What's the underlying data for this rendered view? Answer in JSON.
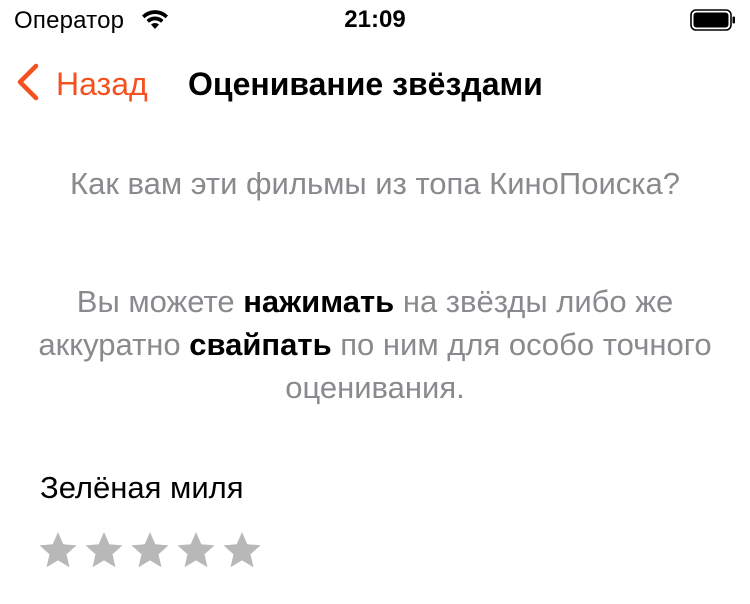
{
  "status_bar": {
    "carrier": "Оператор",
    "time": "21:09"
  },
  "nav": {
    "back_label": "Назад",
    "title": "Оценивание звёздами"
  },
  "content": {
    "question": "Как вам эти фильмы из топа КиноПоиска?",
    "instructions": {
      "part1": "Вы можете ",
      "bold1": "нажимать",
      "part2": " на звёзды либо же аккуратно ",
      "bold2": "свайпать",
      "part3": " по ним для особо точного оценивания."
    }
  },
  "movies": [
    {
      "title": "Зелёная миля",
      "rating": 0,
      "max_rating": 5
    }
  ],
  "colors": {
    "accent": "#f4511e",
    "secondary_text": "#8a8a8e",
    "star_empty": "#b8b8b8"
  },
  "icons": {
    "back": "chevron-left-icon",
    "wifi": "wifi-icon",
    "battery": "battery-icon",
    "star": "star-icon"
  }
}
